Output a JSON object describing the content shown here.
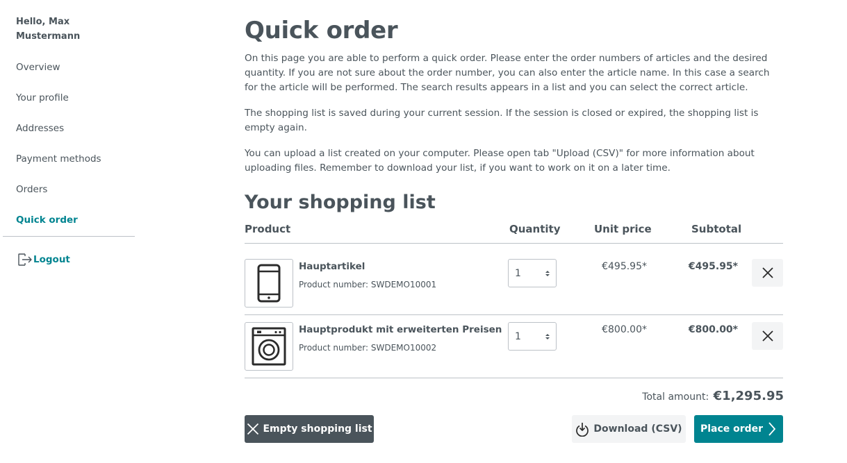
{
  "sidebar": {
    "greeting": "Hello, Max Mustermann",
    "items": [
      {
        "label": "Overview"
      },
      {
        "label": "Your profile"
      },
      {
        "label": "Addresses"
      },
      {
        "label": "Payment methods"
      },
      {
        "label": "Orders"
      },
      {
        "label": "Quick order",
        "active": true
      }
    ],
    "logout_label": "Logout",
    "logout_icon": "logout-icon"
  },
  "main": {
    "title": "Quick order",
    "paragraphs": [
      "On this page you are able to perform a quick order. Please enter the order numbers of articles and the desired quantity. If you are not sure about the order number, you can also enter the article name. In this case a search for the article will be performed. The search results appears in a list and you can select the correct article.",
      "The shopping list is saved during your current session. If the session is closed or expired, the shopping list is empty again.",
      "You can upload a list created on your computer. Please open tab \"Upload (CSV)\" for more information about uploading files. Remember to download your list, if you want to work on it on a later time."
    ],
    "list_title": "Your shopping list",
    "columns": {
      "product": "Product",
      "quantity": "Quantity",
      "unit_price": "Unit price",
      "subtotal": "Subtotal"
    },
    "items": [
      {
        "name": "Hauptartikel",
        "number": "Product number: SWDEMO10001",
        "quantity": "1",
        "unit_price": "€495.95*",
        "subtotal": "€495.95*",
        "icon": "smartphone-icon"
      },
      {
        "name": "Hauptprodukt mit erweiterten Preisen",
        "number": "Product number: SWDEMO10002",
        "quantity": "1",
        "unit_price": "€800.00*",
        "subtotal": "€800.00*",
        "icon": "washing-machine-icon"
      }
    ],
    "total_label": "Total amount:",
    "total_value": "€1,295.95",
    "buttons": {
      "empty": "Empty shopping list",
      "download": "Download (CSV)",
      "order": "Place order"
    }
  },
  "colors": {
    "accent": "#008490",
    "text": "#4a545b",
    "border": "#bcc1c7",
    "light_bg": "#f3f4f5"
  }
}
